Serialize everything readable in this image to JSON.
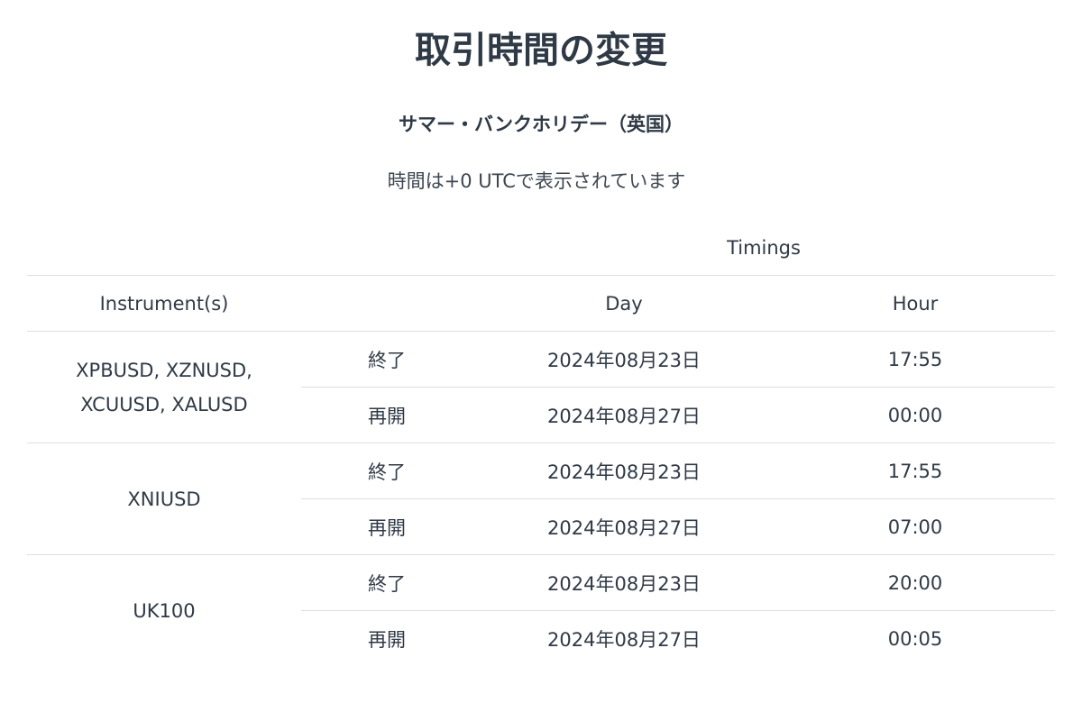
{
  "title": "取引時間の変更",
  "subtitle": "サマー・バンクホリデー（英国）",
  "timezone_note": "時間は+0 UTCで表示されています",
  "table": {
    "group_header": "Timings",
    "columns": {
      "instrument": "Instrument(s)",
      "day": "Day",
      "hour": "Hour"
    },
    "groups": [
      {
        "instrument_line1": "XPBUSD, XZNUSD,",
        "instrument_line2": "XCUUSD, XALUSD",
        "rows": [
          {
            "event": "終了",
            "day": "2024年08月23日",
            "hour": "17:55"
          },
          {
            "event": "再開",
            "day": "2024年08月27日",
            "hour": "00:00"
          }
        ]
      },
      {
        "instrument_line1": "XNIUSD",
        "instrument_line2": "",
        "rows": [
          {
            "event": "終了",
            "day": "2024年08月23日",
            "hour": "17:55"
          },
          {
            "event": "再開",
            "day": "2024年08月27日",
            "hour": "07:00"
          }
        ]
      },
      {
        "instrument_line1": "UK100",
        "instrument_line2": "",
        "rows": [
          {
            "event": "終了",
            "day": "2024年08月23日",
            "hour": "20:00"
          },
          {
            "event": "再開",
            "day": "2024年08月27日",
            "hour": "00:05"
          }
        ]
      }
    ]
  }
}
